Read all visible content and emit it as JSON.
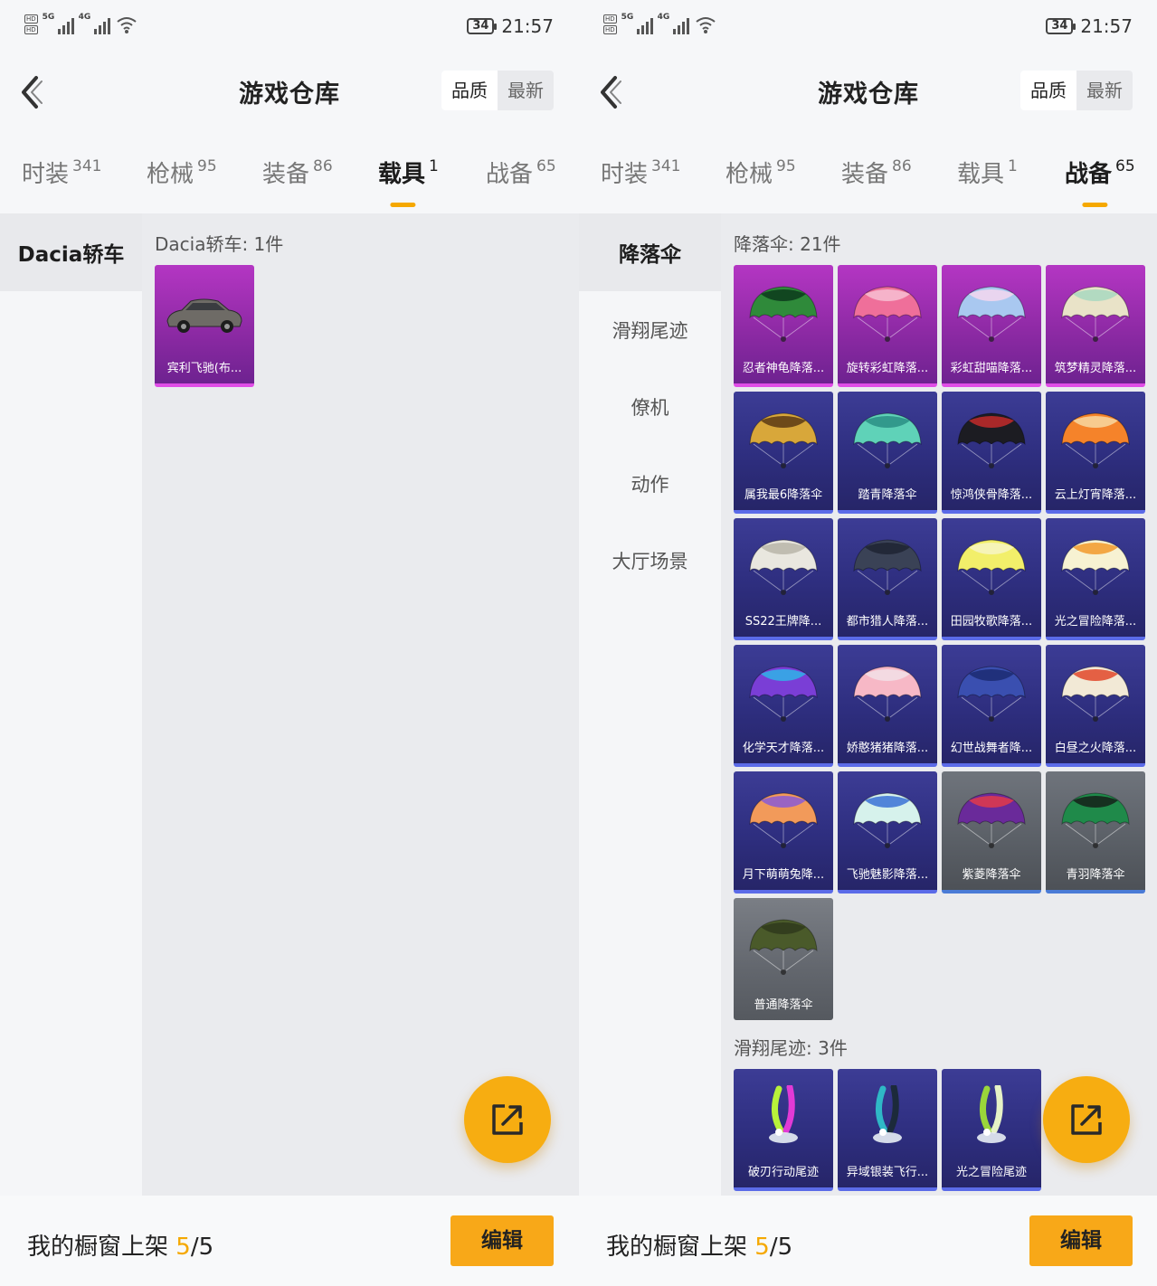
{
  "status": {
    "time": "21:57",
    "battery": "34",
    "net1": "5G",
    "net2": "4G"
  },
  "header": {
    "title": "游戏仓库",
    "sort_quality": "品质",
    "sort_newest": "最新"
  },
  "tabs": [
    {
      "label": "时装",
      "count": "341"
    },
    {
      "label": "枪械",
      "count": "95"
    },
    {
      "label": "装备",
      "count": "86"
    },
    {
      "label": "载具",
      "count": "1"
    },
    {
      "label": "战备",
      "count": "65"
    }
  ],
  "panel_left": {
    "active_tab": "载具",
    "side_items": [
      "Dacia轿车"
    ],
    "section": {
      "title": "Dacia轿车: 1件",
      "items": [
        {
          "name": "宾利飞驰(布...",
          "rarity": "purple",
          "icon": "car-icon"
        }
      ]
    }
  },
  "panel_right": {
    "active_tab": "战备",
    "side_items": [
      "降落伞",
      "滑翔尾迹",
      "僚机",
      "动作",
      "大厅场景"
    ],
    "sections": [
      {
        "title": "降落伞: 21件",
        "items": [
          {
            "name": "忍者神龟降落...",
            "rarity": "purple",
            "colors": [
              "#2f8a3a",
              "#0c3a1c"
            ]
          },
          {
            "name": "旋转彩虹降落...",
            "rarity": "purple",
            "colors": [
              "#ef6f9a",
              "#f7bfd2"
            ]
          },
          {
            "name": "彩虹甜喵降落...",
            "rarity": "purple",
            "colors": [
              "#a9c8f0",
              "#f5d7ef"
            ]
          },
          {
            "name": "筑梦精灵降落...",
            "rarity": "purple",
            "colors": [
              "#e9e3c8",
              "#a8d8c0"
            ]
          },
          {
            "name": "属我最6降落伞",
            "rarity": "blue",
            "colors": [
              "#d8a73a",
              "#5c3a14"
            ]
          },
          {
            "name": "踏青降落伞",
            "rarity": "blue",
            "colors": [
              "#5fd2b8",
              "#2a8f84"
            ]
          },
          {
            "name": "惊鸿侠骨降落...",
            "rarity": "blue",
            "colors": [
              "#1c1c22",
              "#c22a2a"
            ]
          },
          {
            "name": "云上灯宵降落...",
            "rarity": "blue",
            "colors": [
              "#f5832a",
              "#f7d8a0"
            ]
          },
          {
            "name": "SS22王牌降...",
            "rarity": "blue",
            "colors": [
              "#e9e7df",
              "#b8b5a9"
            ]
          },
          {
            "name": "都市猎人降落...",
            "rarity": "blue",
            "colors": [
              "#3a4256",
              "#1e2332"
            ]
          },
          {
            "name": "田园牧歌降落...",
            "rarity": "blue",
            "colors": [
              "#f2ef6a",
              "#f7f5c4"
            ]
          },
          {
            "name": "光之冒险降落...",
            "rarity": "blue",
            "colors": [
              "#f7f2d2",
              "#f29a2c"
            ]
          },
          {
            "name": "化学天才降落...",
            "rarity": "blue",
            "colors": [
              "#7a3ed6",
              "#2fb3e8"
            ]
          },
          {
            "name": "娇憨猪猪降落...",
            "rarity": "blue",
            "colors": [
              "#f7b8c6",
              "#f2dfe6"
            ]
          },
          {
            "name": "幻世战舞者降...",
            "rarity": "blue",
            "colors": [
              "#3a4fb0",
              "#1c2a72"
            ]
          },
          {
            "name": "白昼之火降落...",
            "rarity": "blue",
            "colors": [
              "#f2e9d6",
              "#e2482a"
            ]
          },
          {
            "name": "月下萌萌兔降...",
            "rarity": "blue",
            "colors": [
              "#f29a5a",
              "#8a5ad6"
            ]
          },
          {
            "name": "飞驰魅影降落...",
            "rarity": "blue",
            "colors": [
              "#d6f2ec",
              "#3a72d6"
            ]
          },
          {
            "name": "紫菱降落伞",
            "rarity": "grey",
            "colors": [
              "#6a2a9a",
              "#e23a4a"
            ]
          },
          {
            "name": "青羽降落伞",
            "rarity": "grey",
            "colors": [
              "#1f8a4a",
              "#152019"
            ]
          },
          {
            "name": "普通降落伞",
            "rarity": "plain",
            "colors": [
              "#4a5a2a",
              "#2f3a1c"
            ]
          }
        ]
      },
      {
        "title": "滑翔尾迹: 3件",
        "items": [
          {
            "name": "破刃行动尾迹",
            "rarity": "blue",
            "colors": [
              "#b8f23a",
              "#e23ad6"
            ]
          },
          {
            "name": "异域银装飞行...",
            "rarity": "blue",
            "colors": [
              "#2fb8c6",
              "#1c2a3a"
            ]
          },
          {
            "name": "光之冒险尾迹",
            "rarity": "blue",
            "colors": [
              "#9ad63a",
              "#e6f2c6"
            ]
          }
        ]
      }
    ]
  },
  "footer": {
    "label": "我的橱窗上架",
    "current": "5",
    "total": "/5",
    "edit_label": "编辑"
  },
  "colors": {
    "accent": "#f5a800",
    "fab": "#f7ad11",
    "purple_rarity": "#b436c3",
    "blue_rarity": "#3c3c95"
  }
}
